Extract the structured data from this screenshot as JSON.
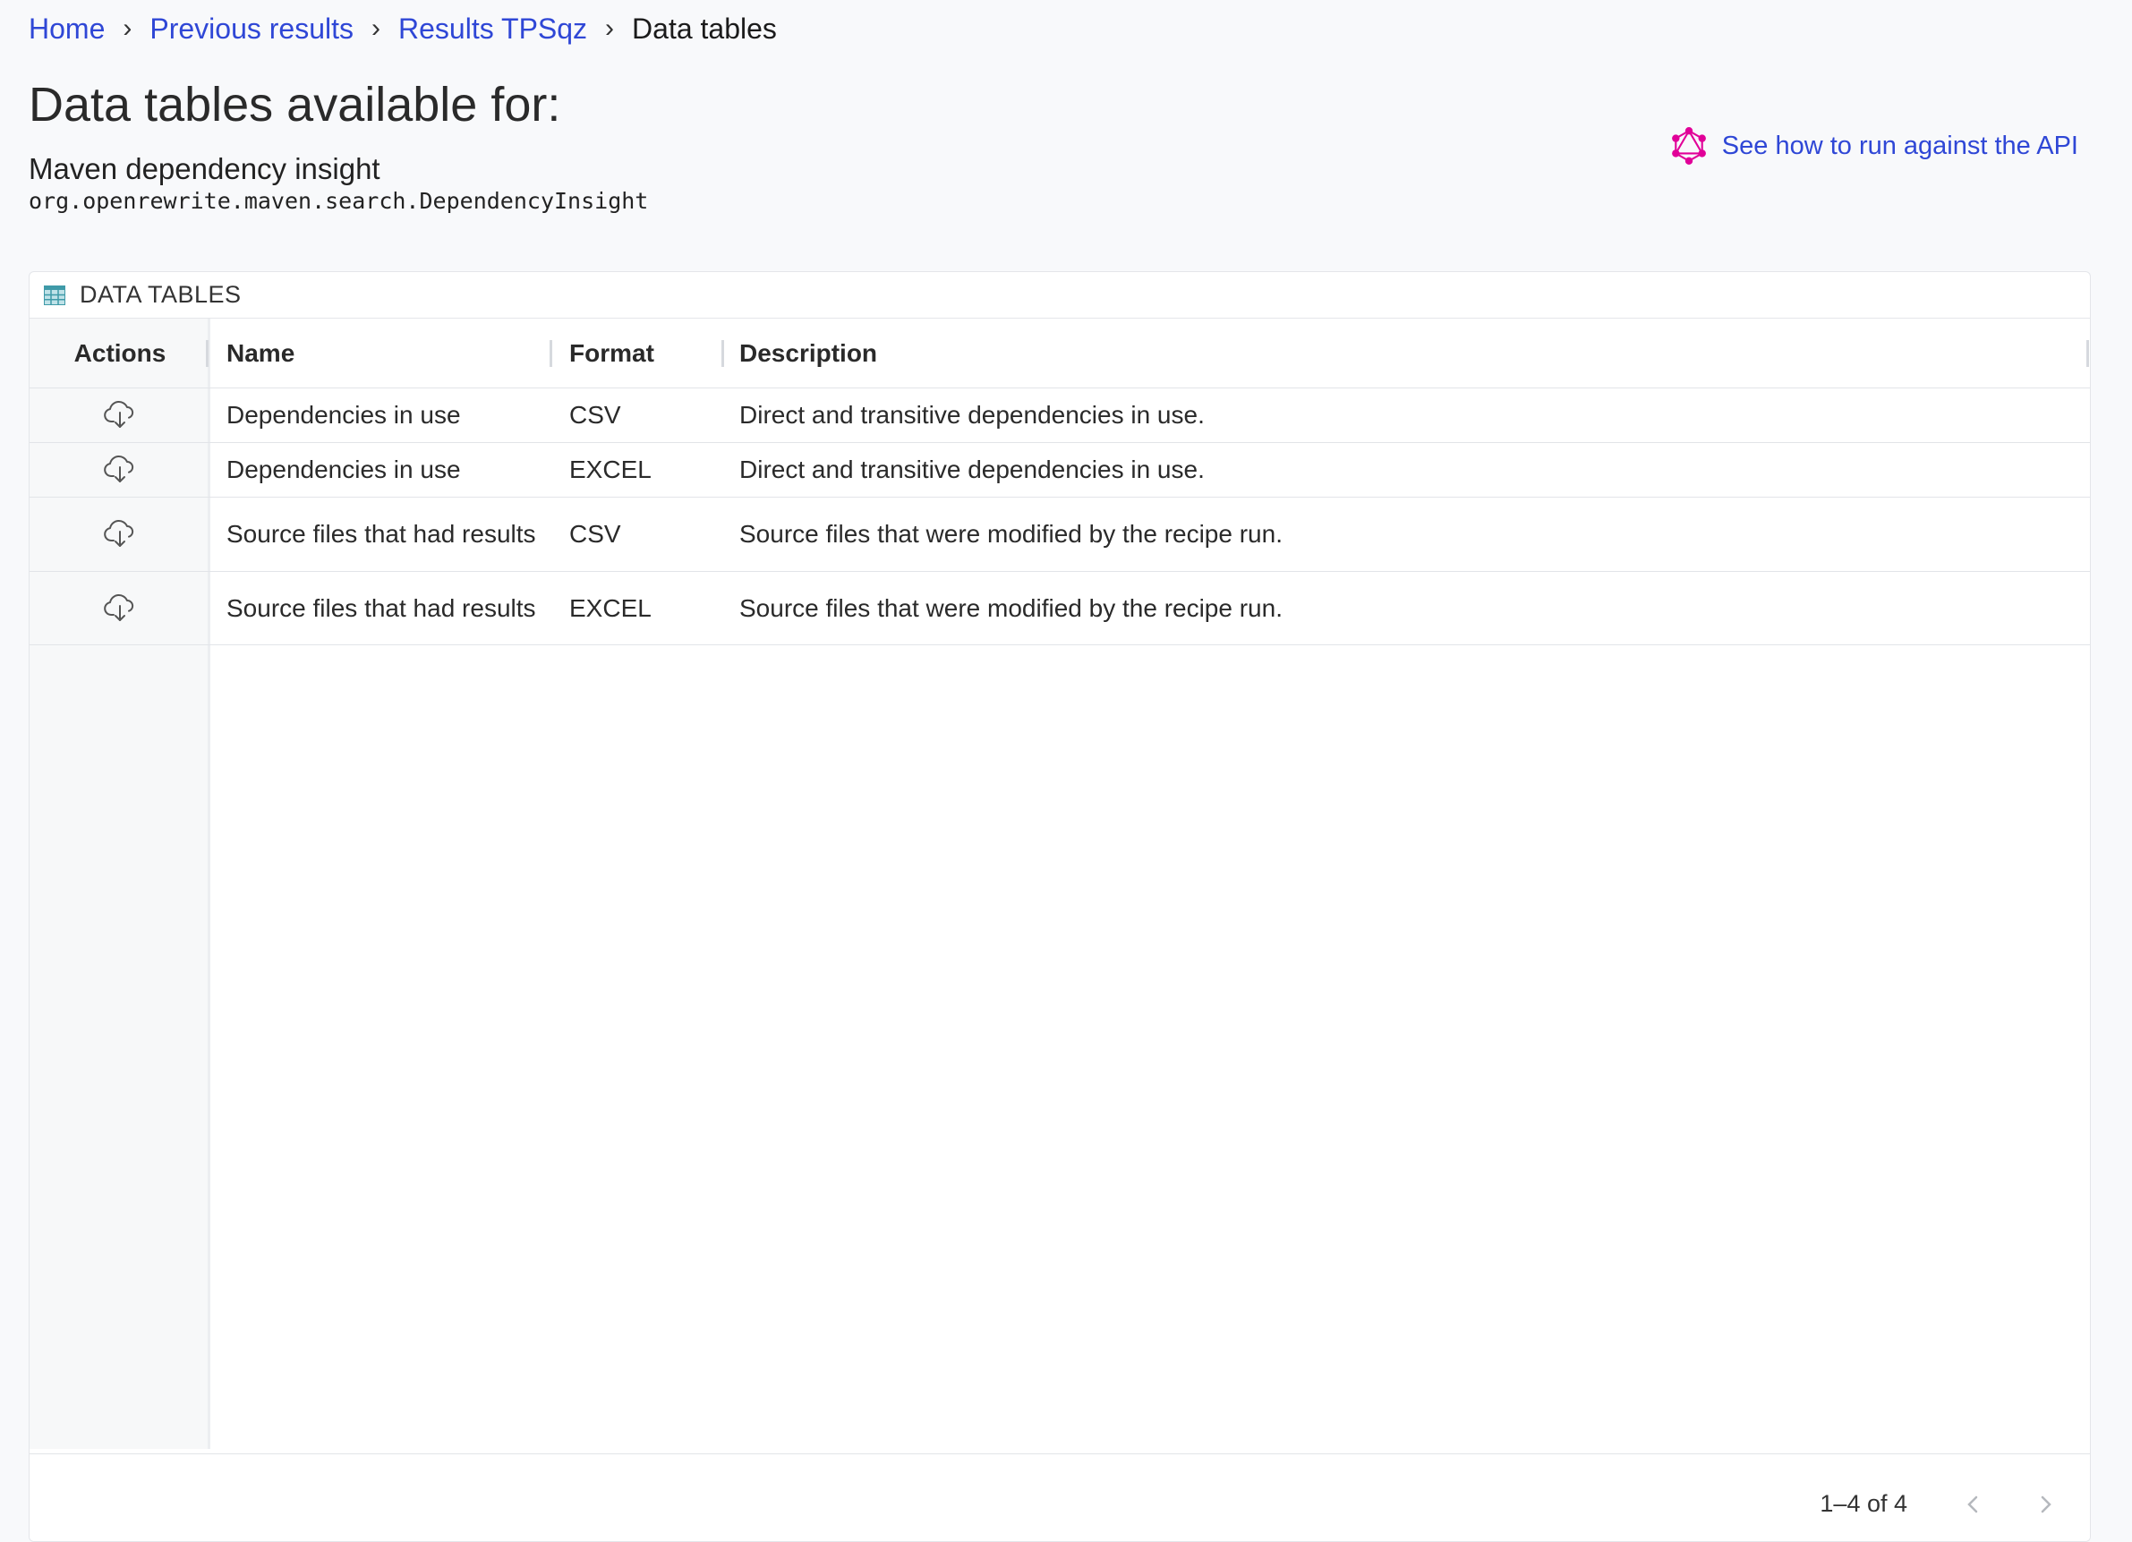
{
  "breadcrumb": {
    "home": "Home",
    "previous": "Previous results",
    "results": "Results TPSqz",
    "current": "Data tables",
    "separator": "›"
  },
  "page": {
    "title": "Data tables available for:",
    "recipe_name": "Maven dependency insight",
    "recipe_id": "org.openrewrite.maven.search.DependencyInsight"
  },
  "api_link": {
    "label": "See how to run against the API",
    "icon": "graphql-icon",
    "color": "#e10098"
  },
  "card": {
    "title": "DATA TABLES",
    "icon": "table-icon"
  },
  "table": {
    "headers": {
      "actions": "Actions",
      "name": "Name",
      "format": "Format",
      "description": "Description"
    },
    "rows": [
      {
        "name": "Dependencies in use",
        "format": "CSV",
        "description": "Direct and transitive dependencies in use."
      },
      {
        "name": "Dependencies in use",
        "format": "EXCEL",
        "description": "Direct and transitive dependencies in use."
      },
      {
        "name": "Source files that had results",
        "format": "CSV",
        "description": "Source files that were modified by the recipe run."
      },
      {
        "name": "Source files that had results",
        "format": "EXCEL",
        "description": "Source files that were modified by the recipe run."
      }
    ]
  },
  "pagination": {
    "text": "1–4 of 4"
  },
  "colors": {
    "link": "#2f47d6",
    "accent": "#e10098"
  }
}
